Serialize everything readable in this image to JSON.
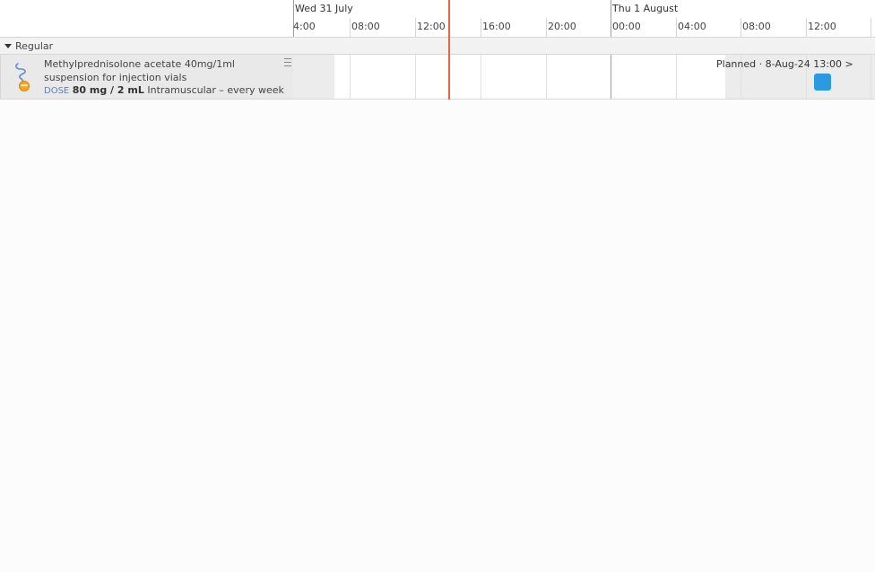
{
  "timeline": {
    "days": [
      {
        "label": "Wed 31 July"
      },
      {
        "label": "Thu 1 August"
      }
    ],
    "hours": [
      "4:00",
      "08:00",
      "12:00",
      "16:00",
      "20:00",
      "00:00",
      "04:00",
      "08:00",
      "12:00"
    ]
  },
  "group": {
    "label": "Regular"
  },
  "medication": {
    "name": "Methylprednisolone acetate 40mg/1ml suspension for injection vials",
    "dose_tag": "DOSE",
    "dose_amount": "80 mg / 2 mL",
    "dose_detail": "Intramuscular – every week",
    "icon": "injection-vial-icon"
  },
  "planned": {
    "text": "Planned · 8-Aug-24 13:00 >"
  },
  "colors": {
    "now_line": "#e8653f",
    "dose_marker": "#2a9be0",
    "dose_tag": "#5b7ec9"
  }
}
